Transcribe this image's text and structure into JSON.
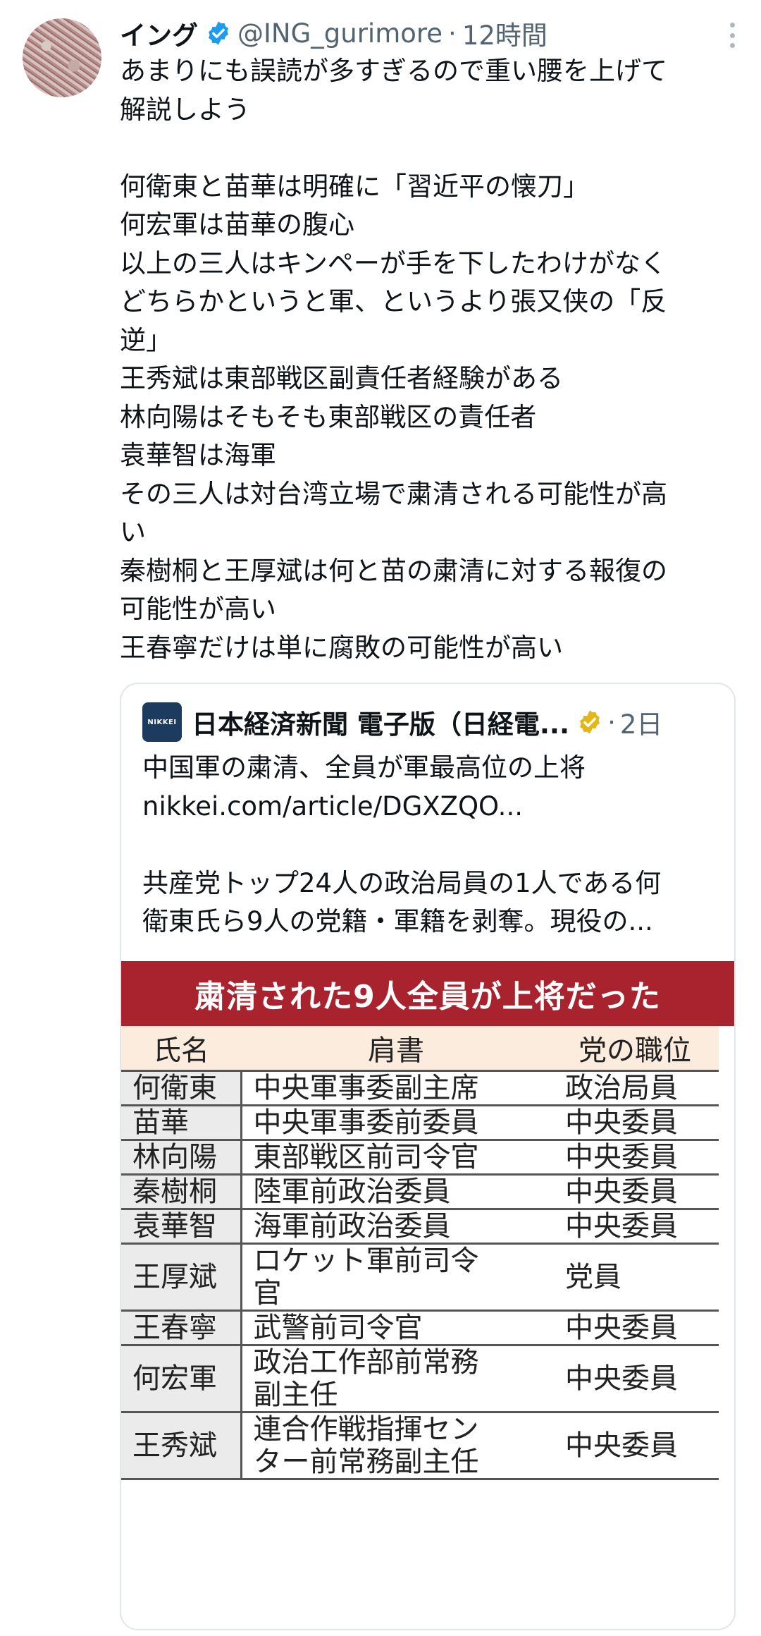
{
  "tweet": {
    "name": "イング",
    "handle": "@ING_gurimore",
    "separator": "·",
    "time": "12時間",
    "lines": [
      "あまりにも誤読が多すぎるので重い腰を上げて",
      "解説しよう",
      "",
      "何衛東と苗華は明確に「習近平の懐刀」",
      "何宏軍は苗華の腹心",
      "以上の三人はキンペーが手を下したわけがなく",
      "どちらかというと軍、というより張又侠の「反",
      "逆」",
      "王秀斌は東部戦区副責任者経験がある",
      "林向陽はそもそも東部戦区の責任者",
      "袁華智は海軍",
      "その三人は対台湾立場で粛清される可能性が高",
      "い",
      "秦樹桐と王厚斌は何と苗の粛清に対する報復の",
      "可能性が高い",
      "王春寧だけは単に腐敗の可能性が高い"
    ]
  },
  "quote": {
    "logo_text": "NIKKEI",
    "name": "日本経済新聞 電子版（日経電...",
    "separator": "·",
    "time": "2日",
    "lines": [
      "中国軍の粛清、全員が軍最高位の上将",
      "nikkei.com/article/DGXZQO...",
      "",
      "共産党トップ24人の政治局員の1人である何",
      "衛東氏ら9人の党籍・軍籍を剥奪。現役の..."
    ],
    "banner": "粛清された9人全員が上将だった",
    "headers": [
      "氏名",
      "肩書",
      "党の職位"
    ],
    "rows": [
      [
        "何衛東",
        "中央軍事委副主席",
        "政治局員"
      ],
      [
        "苗華",
        "中央軍事委前委員",
        "中央委員"
      ],
      [
        "林向陽",
        "東部戦区前司令官",
        "中央委員"
      ],
      [
        "秦樹桐",
        "陸軍前政治委員",
        "中央委員"
      ],
      [
        "袁華智",
        "海軍前政治委員",
        "中央委員"
      ],
      [
        "王厚斌",
        "ロケット軍前司令\n官",
        "党員"
      ],
      [
        "王春寧",
        "武警前司令官",
        "中央委員"
      ],
      [
        "何宏軍",
        "政治工作部前常務\n副主任",
        "中央委員"
      ],
      [
        "王秀斌",
        "連合作戦指揮セン\nター前常務副主任",
        "中央委員"
      ]
    ]
  },
  "colors": {
    "verified_blue": "#1d9bf0",
    "verified_gold": "#e2b719",
    "banner_red": "#a8232d",
    "header_cream": "#fbecde"
  }
}
